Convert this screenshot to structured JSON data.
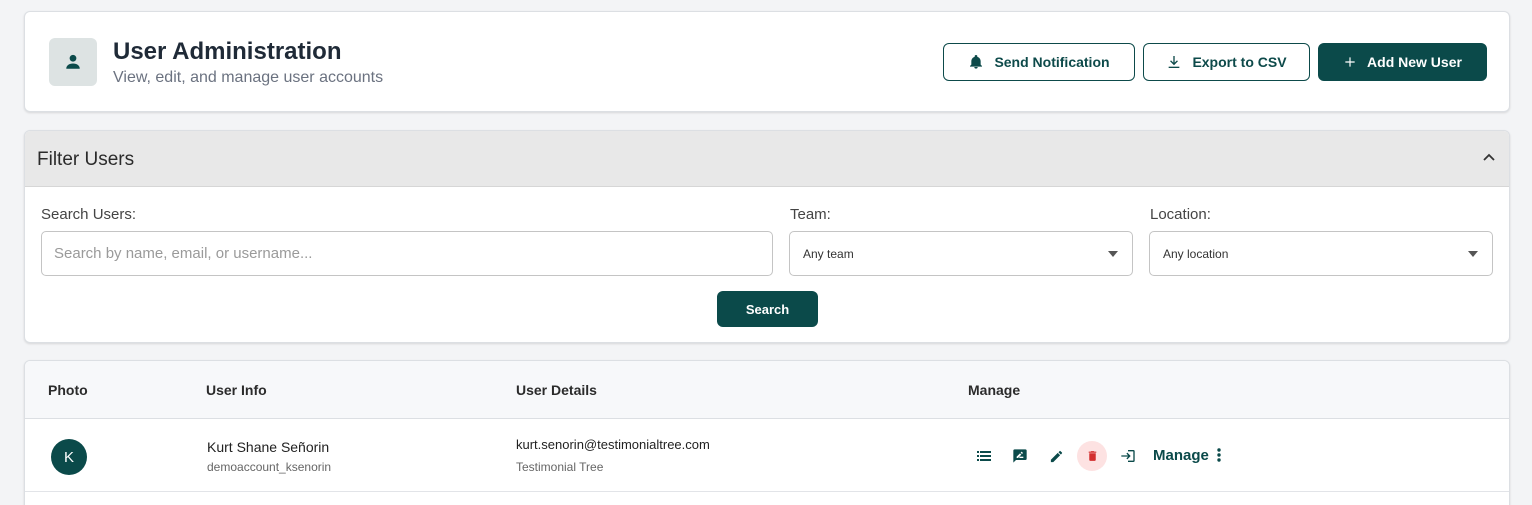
{
  "header": {
    "title": "User Administration",
    "subtitle": "View, edit, and manage user accounts",
    "buttons": {
      "send_notification": "Send Notification",
      "export_csv": "Export to CSV",
      "add_user": "Add New User"
    },
    "icon": "user-icon"
  },
  "filter": {
    "title": "Filter Users",
    "search_label": "Search Users:",
    "search_placeholder": "Search by name, email, or username...",
    "search_value": "",
    "team_label": "Team:",
    "team_value": "Any team",
    "location_label": "Location:",
    "location_value": "Any location",
    "search_button": "Search"
  },
  "table": {
    "columns": [
      "Photo",
      "User Info",
      "User Details",
      "Manage"
    ],
    "rows": [
      {
        "avatar_initial": "K",
        "name": "Kurt Shane Señorin",
        "username": "demoaccount_ksenorin",
        "email": "kurt.senorin@testimonialtree.com",
        "organization": "Testimonial Tree",
        "manage_label": "Manage",
        "actions": [
          "list-icon",
          "feedback-icon",
          "edit-icon",
          "delete-icon",
          "login-icon",
          "more-vertical-icon"
        ]
      }
    ]
  },
  "colors": {
    "primary": "#0b4a4a",
    "delete_bg": "#fde2e2",
    "delete_icon": "#d32f2f",
    "page_bg": "#f3f4f6"
  }
}
